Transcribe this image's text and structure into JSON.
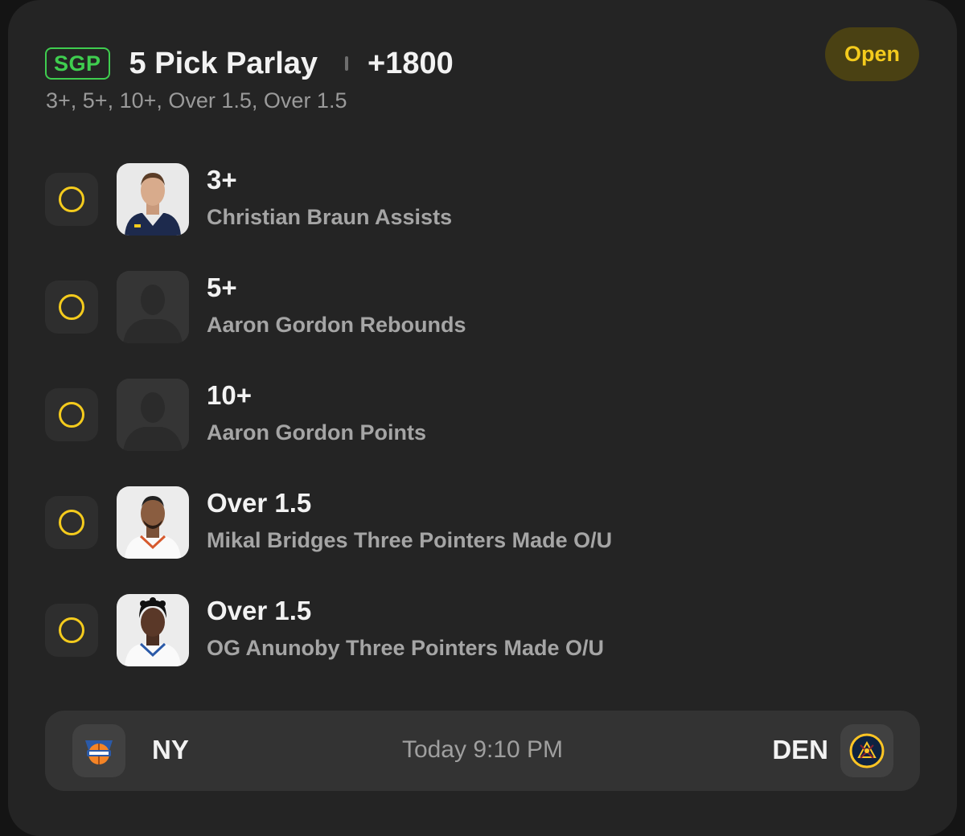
{
  "parlay": {
    "badge": "SGP",
    "title": "5 Pick Parlay",
    "odds": "+1800",
    "summary": "3+, 5+, 10+, Over 1.5, Over 1.5",
    "status": "Open"
  },
  "picks": [
    {
      "line": "3+",
      "description": "Christian Braun Assists",
      "avatar": "player-photo"
    },
    {
      "line": "5+",
      "description": "Aaron Gordon Rebounds",
      "avatar": "placeholder-silhouette"
    },
    {
      "line": "10+",
      "description": "Aaron Gordon Points",
      "avatar": "placeholder-silhouette"
    },
    {
      "line": "Over 1.5",
      "description": "Mikal Bridges Three Pointers Made O/U",
      "avatar": "player-photo"
    },
    {
      "line": "Over 1.5",
      "description": "OG Anunoby Three Pointers Made O/U",
      "avatar": "player-photo"
    }
  ],
  "game": {
    "away_team": "NY",
    "home_team": "DEN",
    "time": "Today 9:10 PM"
  },
  "colors": {
    "card_bg": "#242424",
    "accent_yellow": "#f4cb1d",
    "sgp_green": "#3fcd4f",
    "status_bg": "#4a4113"
  }
}
